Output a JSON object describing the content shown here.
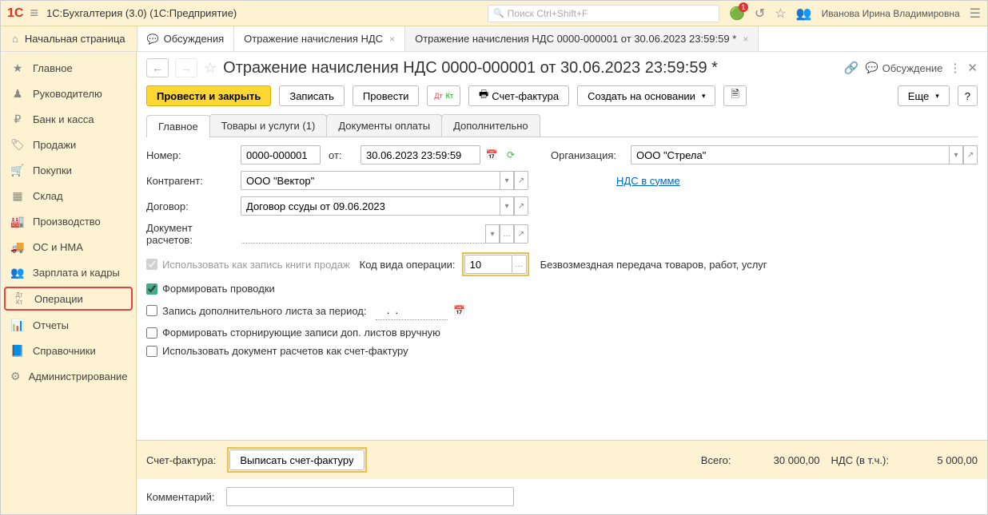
{
  "topbar": {
    "logo": "1С",
    "app_title": "1С:Бухгалтерия (3.0)  (1С:Предприятие)",
    "search_placeholder": "Поиск Ctrl+Shift+F",
    "bell_badge": "1",
    "user": "Иванова Ирина Владимировна"
  },
  "tabs": {
    "home": "Начальная страница",
    "items": [
      {
        "icon": "💬",
        "label": "Обсуждения"
      },
      {
        "icon": "",
        "label": "Отражение начисления НДС"
      },
      {
        "icon": "",
        "label": "Отражение начисления НДС 0000-000001 от 30.06.2023 23:59:59 *",
        "active": true
      }
    ]
  },
  "sidebar": [
    {
      "icon": "★",
      "label": "Главное"
    },
    {
      "icon": "👤",
      "label": "Руководителю"
    },
    {
      "icon": "₽",
      "label": "Банк и касса"
    },
    {
      "icon": "🏷",
      "label": "Продажи"
    },
    {
      "icon": "🛒",
      "label": "Покупки"
    },
    {
      "icon": "▦",
      "label": "Склад"
    },
    {
      "icon": "🏭",
      "label": "Производство"
    },
    {
      "icon": "🚚",
      "label": "ОС и НМА"
    },
    {
      "icon": "👥",
      "label": "Зарплата и кадры"
    },
    {
      "icon": "Дт/Кт",
      "label": "Операции",
      "hl": true
    },
    {
      "icon": "📊",
      "label": "Отчеты"
    },
    {
      "icon": "📘",
      "label": "Справочники"
    },
    {
      "icon": "⚙",
      "label": "Администрирование"
    }
  ],
  "doc": {
    "title": "Отражение начисления НДС 0000-000001 от 30.06.2023 23:59:59 *",
    "discuss": "Обсуждение"
  },
  "toolbar": {
    "post_close": "Провести и закрыть",
    "save": "Записать",
    "post": "Провести",
    "invoice": "Счет-фактура",
    "create_based": "Создать на основании",
    "more": "Еще"
  },
  "formtabs": [
    "Главное",
    "Товары и услуги (1)",
    "Документы оплаты",
    "Дополнительно"
  ],
  "form": {
    "number_lbl": "Номер:",
    "number": "0000-000001",
    "from_lbl": "от:",
    "date": "30.06.2023 23:59:59",
    "org_lbl": "Организация:",
    "org": "ООО \"Стрела\"",
    "contr_lbl": "Контрагент:",
    "contr": "ООО \"Вектор\"",
    "nds_link": "НДС в сумме",
    "contract_lbl": "Договор:",
    "contract": "Договор ссуды от 09.06.2023",
    "settle_lbl": "Документ расчетов:",
    "settle": "",
    "use_sales_book": "Использовать как запись книги продаж",
    "opcode_lbl": "Код вида операции:",
    "opcode": "10",
    "opcode_desc": "Безвозмездная передача товаров, работ, услуг",
    "form_entries": "Формировать проводки",
    "extra_sheet": "Запись дополнительного листа за период:",
    "extra_date": "  .  .    ",
    "storno": "Формировать сторнирующие записи доп. листов вручную",
    "use_settle_invoice": "Использовать документ расчетов как счет-фактуру"
  },
  "footer": {
    "invoice_lbl": "Счет-фактура:",
    "write_invoice": "Выписать счет-фактуру",
    "total_lbl": "Всего:",
    "total": "30 000,00",
    "nds_lbl": "НДС (в т.ч.):",
    "nds": "5 000,00",
    "comment_lbl": "Комментарий:"
  }
}
